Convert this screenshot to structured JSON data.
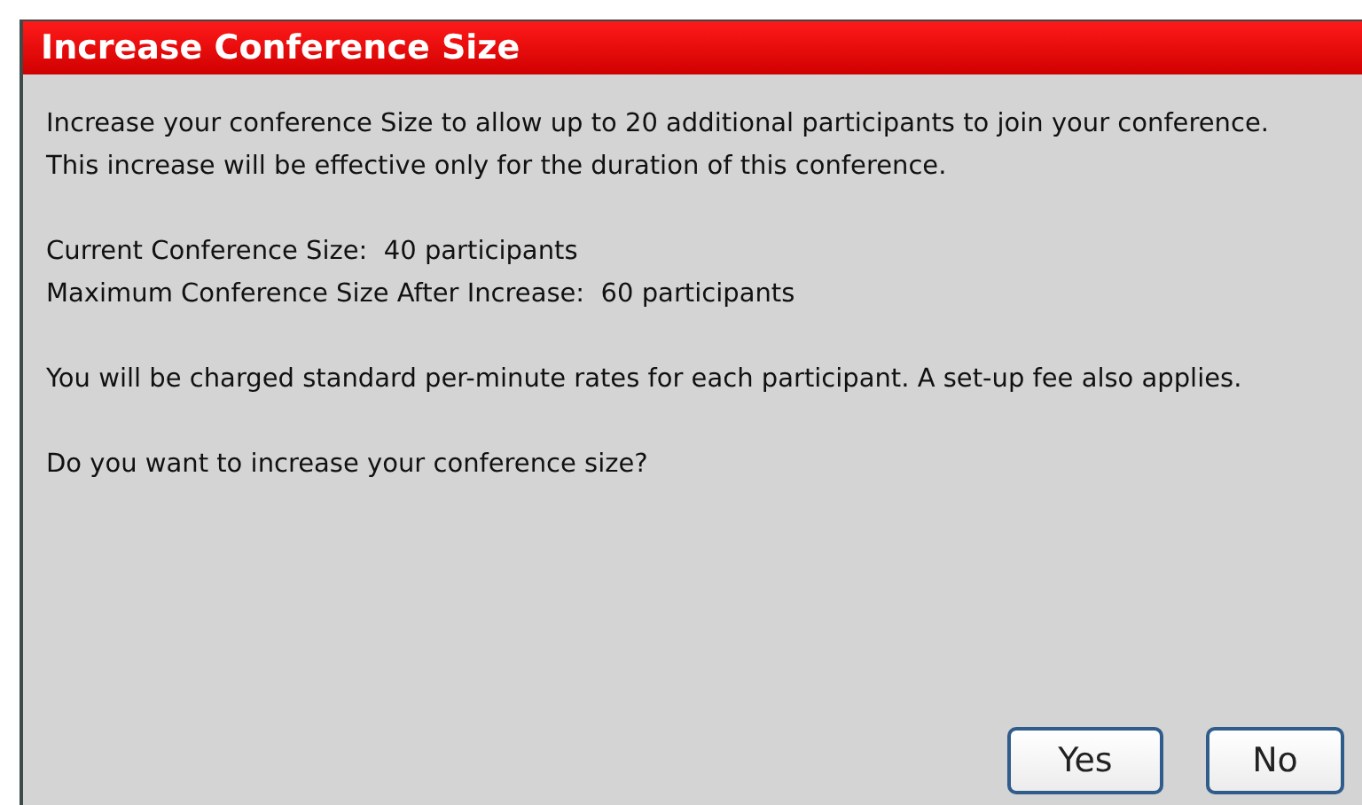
{
  "dialog": {
    "title": "Increase Conference Size",
    "paragraphs": [
      {
        "lines": [
          "Increase your conference Size to allow up to 20 additional participants to join your conference. This increase will be effective only for the duration of this conference."
        ]
      },
      {
        "lines": [
          "Current Conference Size:  40 participants",
          "Maximum Conference Size After Increase:  60 participants"
        ]
      },
      {
        "lines": [
          "You will be charged standard per-minute rates for each participant. A set-up fee also applies."
        ]
      },
      {
        "lines": [
          "Do you want to increase your conference size?"
        ]
      }
    ],
    "buttons": [
      "Yes",
      "No"
    ]
  }
}
